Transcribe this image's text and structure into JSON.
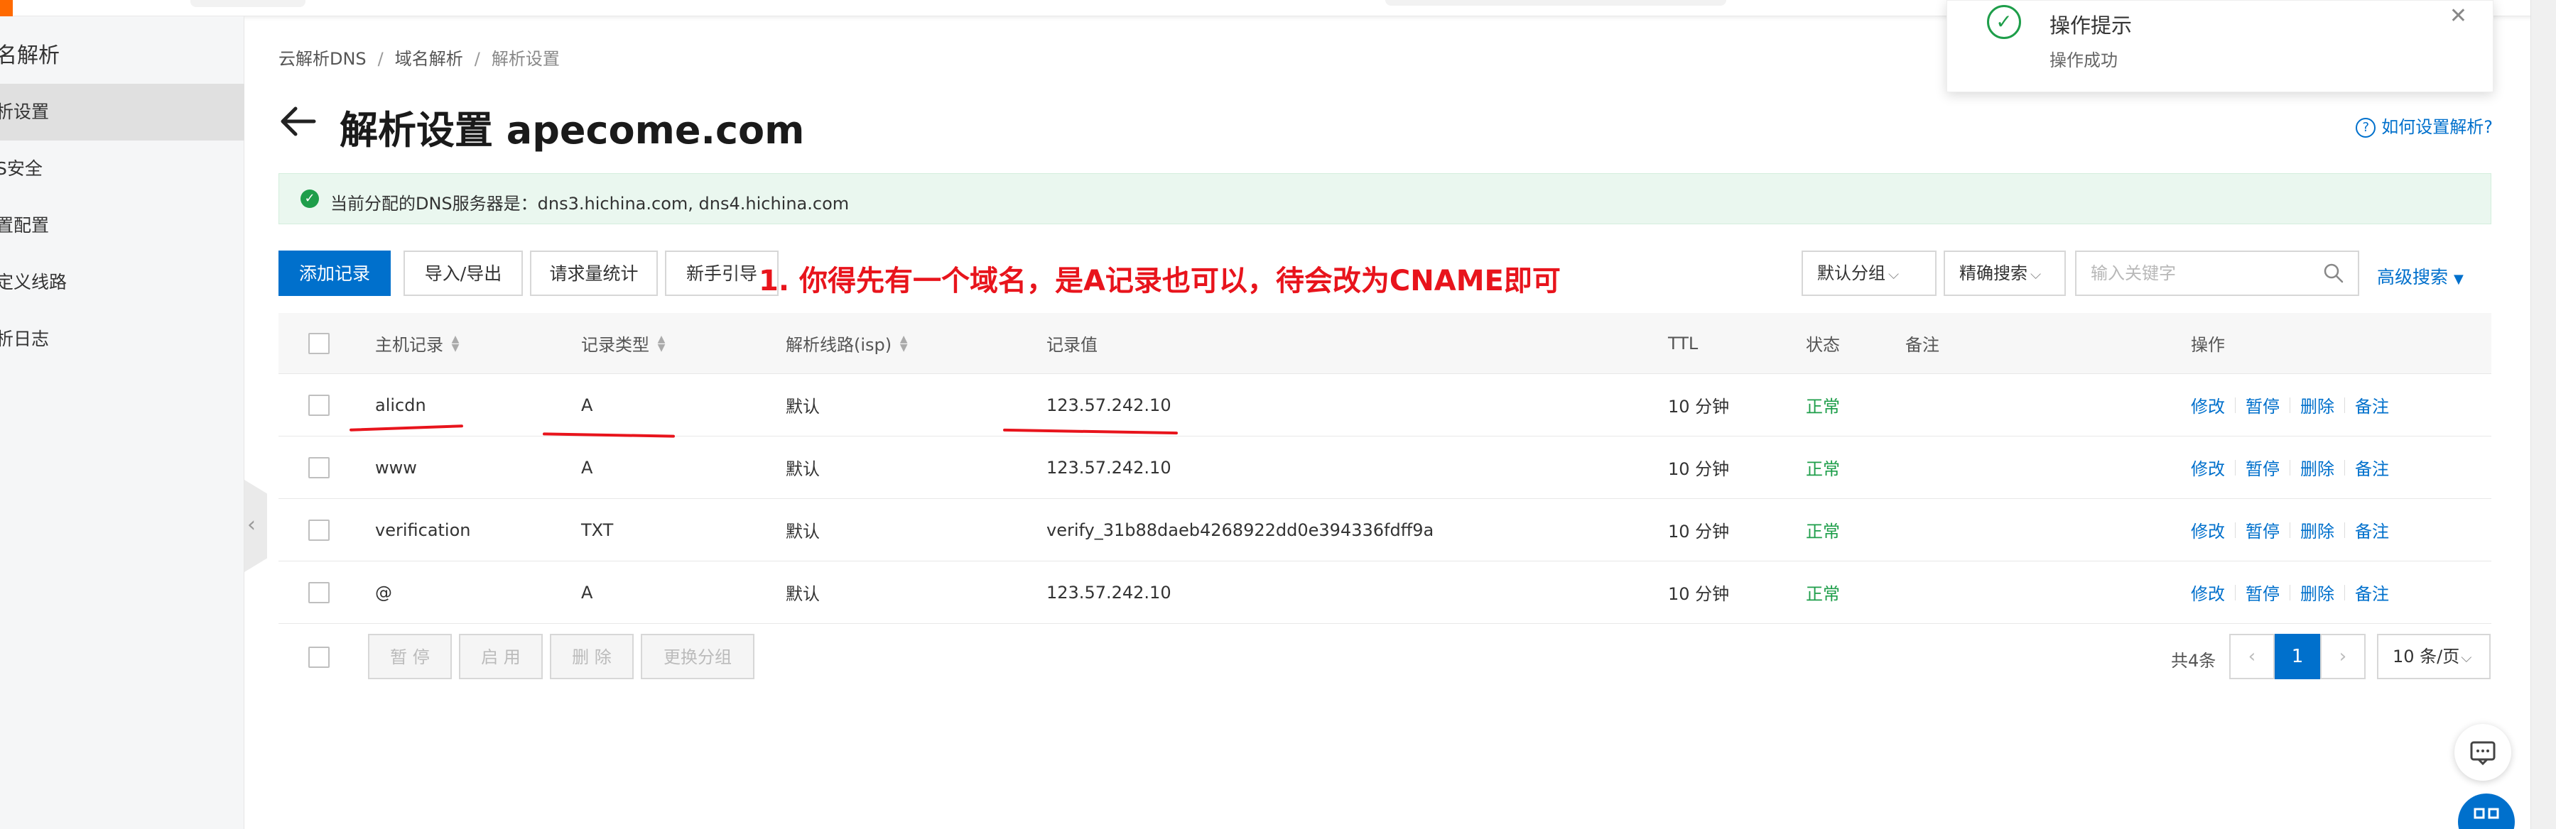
{
  "sidebar": {
    "title": "名解析",
    "items": [
      {
        "label": "析设置",
        "active": true
      },
      {
        "label": "S安全",
        "active": false
      },
      {
        "label": "置配置",
        "active": false
      },
      {
        "label": "定义线路",
        "active": false
      },
      {
        "label": "析日志",
        "active": false
      }
    ]
  },
  "breadcrumb": {
    "items": [
      "云解析DNS",
      "域名解析",
      "解析设置"
    ],
    "separator": "/"
  },
  "page": {
    "title": "解析设置 apecome.com",
    "help_link": "如何设置解析?"
  },
  "notice": {
    "text": "当前分配的DNS服务器是：dns3.hichina.com, dns4.hichina.com"
  },
  "toolbar": {
    "add_record": "添加记录",
    "import_export": "导入/导出",
    "request_stats": "请求量统计",
    "beginner_guide": "新手引导",
    "group_select": "默认分组",
    "search_mode": "精确搜索",
    "search_placeholder": "输入关键字",
    "advanced_search": "高级搜索"
  },
  "annotation": {
    "text": "1. 你得先有一个域名，是A记录也可以，待会改为CNAME即可",
    "color": "#e8141c"
  },
  "table": {
    "headers": {
      "host": "主机记录",
      "type": "记录类型",
      "line": "解析线路(isp)",
      "value": "记录值",
      "ttl": "TTL",
      "status": "状态",
      "remark": "备注",
      "actions": "操作"
    },
    "actions": [
      "修改",
      "暂停",
      "删除",
      "备注"
    ],
    "rows": [
      {
        "host": "alicdn",
        "type": "A",
        "line": "默认",
        "value": "123.57.242.10",
        "ttl": "10 分钟",
        "status": "正常",
        "remark": ""
      },
      {
        "host": "www",
        "type": "A",
        "line": "默认",
        "value": "123.57.242.10",
        "ttl": "10 分钟",
        "status": "正常",
        "remark": ""
      },
      {
        "host": "verification",
        "type": "TXT",
        "line": "默认",
        "value": "verify_31b88daeb4268922dd0e394336fdff9a",
        "ttl": "10 分钟",
        "status": "正常",
        "remark": ""
      },
      {
        "host": "@",
        "type": "A",
        "line": "默认",
        "value": "123.57.242.10",
        "ttl": "10 分钟",
        "status": "正常",
        "remark": ""
      }
    ]
  },
  "footer": {
    "pause": "暂 停",
    "enable": "启 用",
    "delete": "删 除",
    "change_group": "更换分组",
    "total": "共4条",
    "current_page": "1",
    "page_size": "10 条/页"
  },
  "toast": {
    "title": "操作提示",
    "message": "操作成功"
  },
  "colors": {
    "primary": "#0070cc",
    "success": "#1e9e4a",
    "annotation": "#e8141c",
    "notice_bg": "#eaf7ef"
  }
}
